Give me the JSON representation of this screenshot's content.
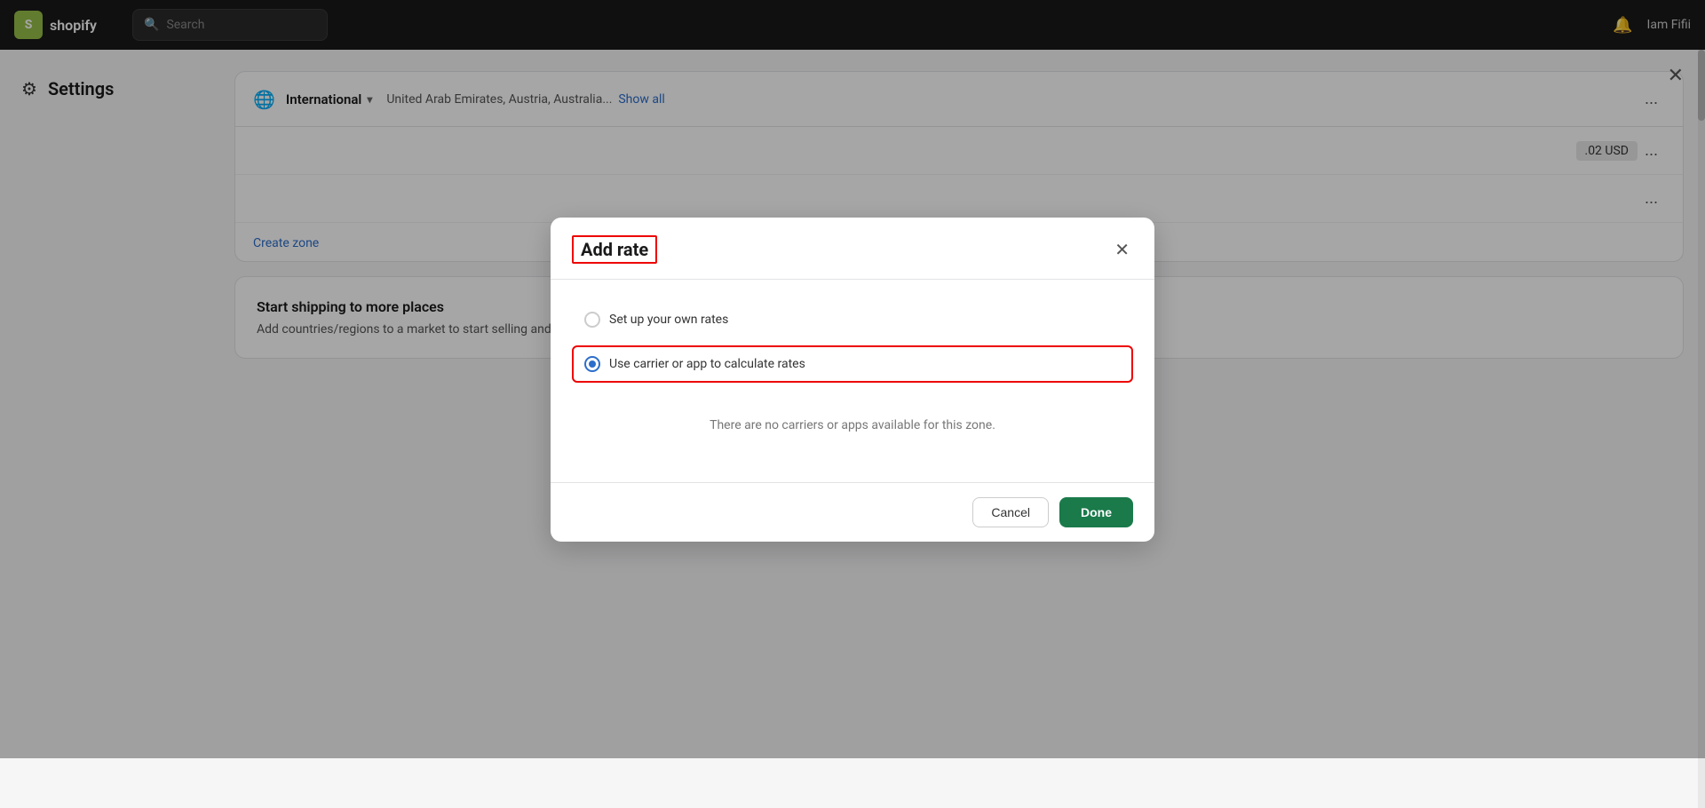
{
  "topbar": {
    "logo_text": "shopify",
    "search_placeholder": "Search",
    "notification_icon": "🔔",
    "user_name": "Iam Fifii"
  },
  "page": {
    "settings_icon": "⚙",
    "title": "Settings",
    "close_icon": "✕"
  },
  "zone_section": {
    "globe_icon": "🌐",
    "zone_name": "International",
    "dropdown_arrow": "▾",
    "countries_text": "United Arab Emirates, Austria, Australia...",
    "show_all_label": "Show all",
    "more_btn_label": "...",
    "rate_row": {
      "price": ".02 USD"
    },
    "create_zone_label": "Create zone"
  },
  "shipping_section": {
    "title": "Start shipping to more places",
    "description": "Add countries/regions to a market to start selling and manage localized settings, including shipping zones."
  },
  "modal": {
    "title": "Add rate",
    "close_icon": "✕",
    "option1_label": "Set up your own rates",
    "option2_label": "Use carrier or app to calculate rates",
    "no_carriers_msg": "There are no carriers or apps available for this zone.",
    "cancel_label": "Cancel",
    "done_label": "Done"
  }
}
